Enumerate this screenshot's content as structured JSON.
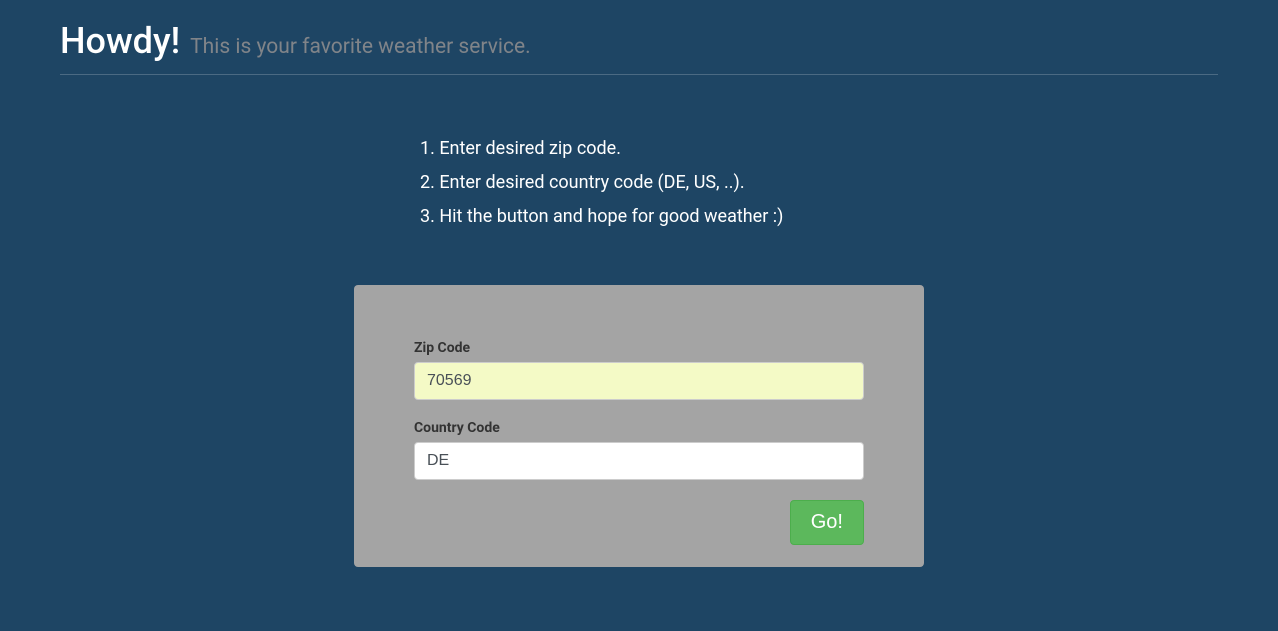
{
  "header": {
    "title": "Howdy!",
    "subtitle": "This is your favorite weather service."
  },
  "instructions": {
    "items": [
      "1. Enter desired zip code.",
      "2. Enter desired country code (DE, US, ..).",
      "3. Hit the button and hope for good weather :)"
    ]
  },
  "form": {
    "zip_label": "Zip Code",
    "zip_value": "70569",
    "country_label": "Country Code",
    "country_value": "DE",
    "go_label": "Go!"
  }
}
